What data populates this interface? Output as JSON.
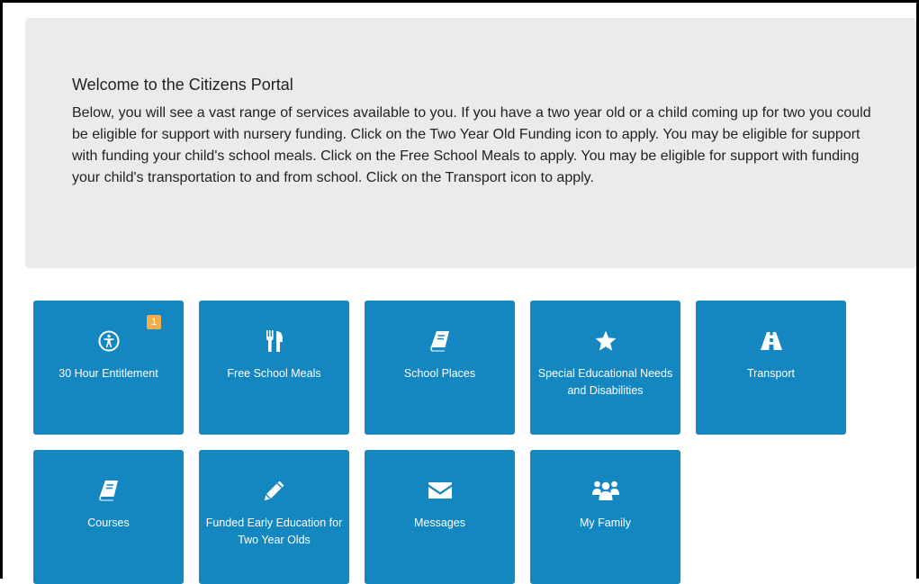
{
  "welcome": {
    "title": "Welcome to the Citizens Portal",
    "body": "Below, you will see a vast range of services available to you. If you have a two year old or a child coming up for two you could be eligible for support with nursery funding. Click on the Two Year Old Funding icon to apply. You may be eligible for support with funding your child's school meals. Click on the Free School Meals to apply. You may be eligible for support with funding your child's transportation to and from school. Click on the Transport icon to apply."
  },
  "colors": {
    "tile": "#1486c0",
    "badge": "#f0ad4e",
    "panel": "#ebebeb"
  },
  "tiles": [
    {
      "label": "30 Hour Entitlement",
      "icon": "accessibility-icon",
      "badge": "1"
    },
    {
      "label": "Free School Meals",
      "icon": "cutlery-icon"
    },
    {
      "label": "School Places",
      "icon": "book-icon"
    },
    {
      "label": "Special Educational Needs and Disabilities",
      "icon": "star-icon"
    },
    {
      "label": "Transport",
      "icon": "road-icon"
    },
    {
      "label": "Courses",
      "icon": "book-icon"
    },
    {
      "label": "Funded Early Education for Two Year Olds",
      "icon": "pencil-icon"
    },
    {
      "label": "Messages",
      "icon": "envelope-icon"
    },
    {
      "label": "My Family",
      "icon": "users-icon"
    }
  ]
}
